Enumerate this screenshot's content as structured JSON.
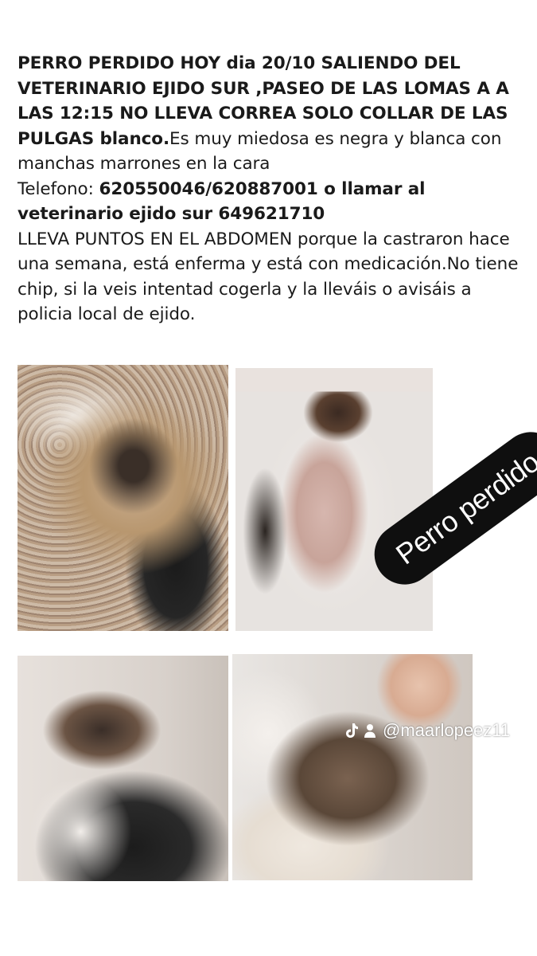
{
  "post": {
    "line1_bold": "PERRO PERDIDO HOY dia 20/10 SALIENDO DEL VETERINARIO EJIDO SUR ,PASEO DE LAS LOMAS A A LAS 12:15 NO LLEVA CORREA SOLO COLLAR DE LAS PULGAS blanco.",
    "line1_regular": "Es muy miedosa es negra y blanca con manchas marrones en la cara",
    "phone_label": "Telefono: ",
    "phone_bold": "620550046/620887001 o llamar al veterinario ejido sur 649621710",
    "body_regular": "LLEVA PUNTOS EN EL ABDOMEN porque la castraron hace una semana, está enferma y está con medicación.No tiene chip, si la veis intentad cogerla y la lleváis o avisáis a policia local de ejido."
  },
  "sticker": {
    "label": "Perro perdido"
  },
  "watermark": {
    "tiktok_icon": "tiktok-icon",
    "person_icon": "person-icon",
    "handle": "@maarlopeez11"
  },
  "photos": [
    {
      "name": "dog-photo-lying-floor"
    },
    {
      "name": "dog-photo-belly-up"
    },
    {
      "name": "dog-photo-portrait"
    },
    {
      "name": "dog-photo-cuddled"
    }
  ],
  "colors": {
    "background": "#ffffff",
    "text": "#1a1a1a",
    "sticker_bg": "#0f0f0f",
    "sticker_text": "#ffffff"
  }
}
